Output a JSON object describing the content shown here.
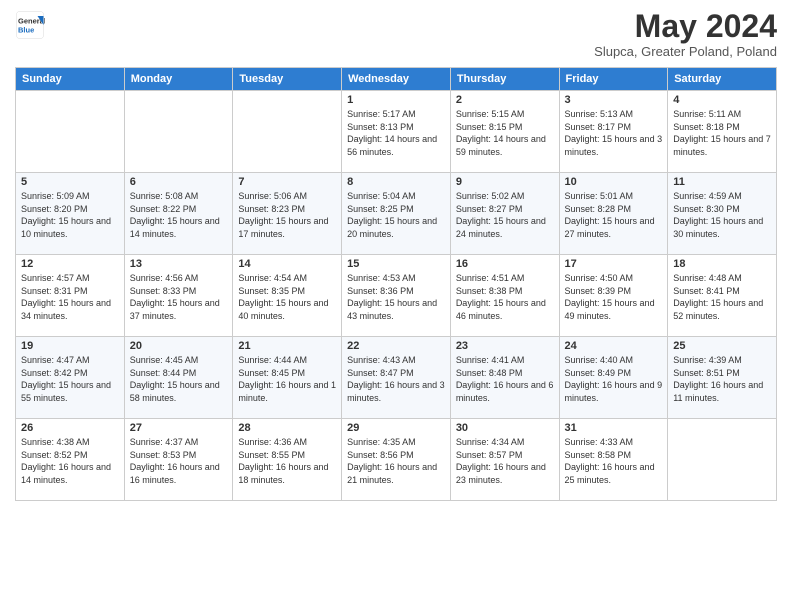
{
  "logo": {
    "general": "General",
    "blue": "Blue"
  },
  "header": {
    "title": "May 2024",
    "subtitle": "Slupca, Greater Poland, Poland"
  },
  "columns": [
    "Sunday",
    "Monday",
    "Tuesday",
    "Wednesday",
    "Thursday",
    "Friday",
    "Saturday"
  ],
  "weeks": [
    [
      {
        "day": "",
        "text": ""
      },
      {
        "day": "",
        "text": ""
      },
      {
        "day": "",
        "text": ""
      },
      {
        "day": "1",
        "text": "Sunrise: 5:17 AM\nSunset: 8:13 PM\nDaylight: 14 hours and 56 minutes."
      },
      {
        "day": "2",
        "text": "Sunrise: 5:15 AM\nSunset: 8:15 PM\nDaylight: 14 hours and 59 minutes."
      },
      {
        "day": "3",
        "text": "Sunrise: 5:13 AM\nSunset: 8:17 PM\nDaylight: 15 hours and 3 minutes."
      },
      {
        "day": "4",
        "text": "Sunrise: 5:11 AM\nSunset: 8:18 PM\nDaylight: 15 hours and 7 minutes."
      }
    ],
    [
      {
        "day": "5",
        "text": "Sunrise: 5:09 AM\nSunset: 8:20 PM\nDaylight: 15 hours and 10 minutes."
      },
      {
        "day": "6",
        "text": "Sunrise: 5:08 AM\nSunset: 8:22 PM\nDaylight: 15 hours and 14 minutes."
      },
      {
        "day": "7",
        "text": "Sunrise: 5:06 AM\nSunset: 8:23 PM\nDaylight: 15 hours and 17 minutes."
      },
      {
        "day": "8",
        "text": "Sunrise: 5:04 AM\nSunset: 8:25 PM\nDaylight: 15 hours and 20 minutes."
      },
      {
        "day": "9",
        "text": "Sunrise: 5:02 AM\nSunset: 8:27 PM\nDaylight: 15 hours and 24 minutes."
      },
      {
        "day": "10",
        "text": "Sunrise: 5:01 AM\nSunset: 8:28 PM\nDaylight: 15 hours and 27 minutes."
      },
      {
        "day": "11",
        "text": "Sunrise: 4:59 AM\nSunset: 8:30 PM\nDaylight: 15 hours and 30 minutes."
      }
    ],
    [
      {
        "day": "12",
        "text": "Sunrise: 4:57 AM\nSunset: 8:31 PM\nDaylight: 15 hours and 34 minutes."
      },
      {
        "day": "13",
        "text": "Sunrise: 4:56 AM\nSunset: 8:33 PM\nDaylight: 15 hours and 37 minutes."
      },
      {
        "day": "14",
        "text": "Sunrise: 4:54 AM\nSunset: 8:35 PM\nDaylight: 15 hours and 40 minutes."
      },
      {
        "day": "15",
        "text": "Sunrise: 4:53 AM\nSunset: 8:36 PM\nDaylight: 15 hours and 43 minutes."
      },
      {
        "day": "16",
        "text": "Sunrise: 4:51 AM\nSunset: 8:38 PM\nDaylight: 15 hours and 46 minutes."
      },
      {
        "day": "17",
        "text": "Sunrise: 4:50 AM\nSunset: 8:39 PM\nDaylight: 15 hours and 49 minutes."
      },
      {
        "day": "18",
        "text": "Sunrise: 4:48 AM\nSunset: 8:41 PM\nDaylight: 15 hours and 52 minutes."
      }
    ],
    [
      {
        "day": "19",
        "text": "Sunrise: 4:47 AM\nSunset: 8:42 PM\nDaylight: 15 hours and 55 minutes."
      },
      {
        "day": "20",
        "text": "Sunrise: 4:45 AM\nSunset: 8:44 PM\nDaylight: 15 hours and 58 minutes."
      },
      {
        "day": "21",
        "text": "Sunrise: 4:44 AM\nSunset: 8:45 PM\nDaylight: 16 hours and 1 minute."
      },
      {
        "day": "22",
        "text": "Sunrise: 4:43 AM\nSunset: 8:47 PM\nDaylight: 16 hours and 3 minutes."
      },
      {
        "day": "23",
        "text": "Sunrise: 4:41 AM\nSunset: 8:48 PM\nDaylight: 16 hours and 6 minutes."
      },
      {
        "day": "24",
        "text": "Sunrise: 4:40 AM\nSunset: 8:49 PM\nDaylight: 16 hours and 9 minutes."
      },
      {
        "day": "25",
        "text": "Sunrise: 4:39 AM\nSunset: 8:51 PM\nDaylight: 16 hours and 11 minutes."
      }
    ],
    [
      {
        "day": "26",
        "text": "Sunrise: 4:38 AM\nSunset: 8:52 PM\nDaylight: 16 hours and 14 minutes."
      },
      {
        "day": "27",
        "text": "Sunrise: 4:37 AM\nSunset: 8:53 PM\nDaylight: 16 hours and 16 minutes."
      },
      {
        "day": "28",
        "text": "Sunrise: 4:36 AM\nSunset: 8:55 PM\nDaylight: 16 hours and 18 minutes."
      },
      {
        "day": "29",
        "text": "Sunrise: 4:35 AM\nSunset: 8:56 PM\nDaylight: 16 hours and 21 minutes."
      },
      {
        "day": "30",
        "text": "Sunrise: 4:34 AM\nSunset: 8:57 PM\nDaylight: 16 hours and 23 minutes."
      },
      {
        "day": "31",
        "text": "Sunrise: 4:33 AM\nSunset: 8:58 PM\nDaylight: 16 hours and 25 minutes."
      },
      {
        "day": "",
        "text": ""
      }
    ]
  ]
}
